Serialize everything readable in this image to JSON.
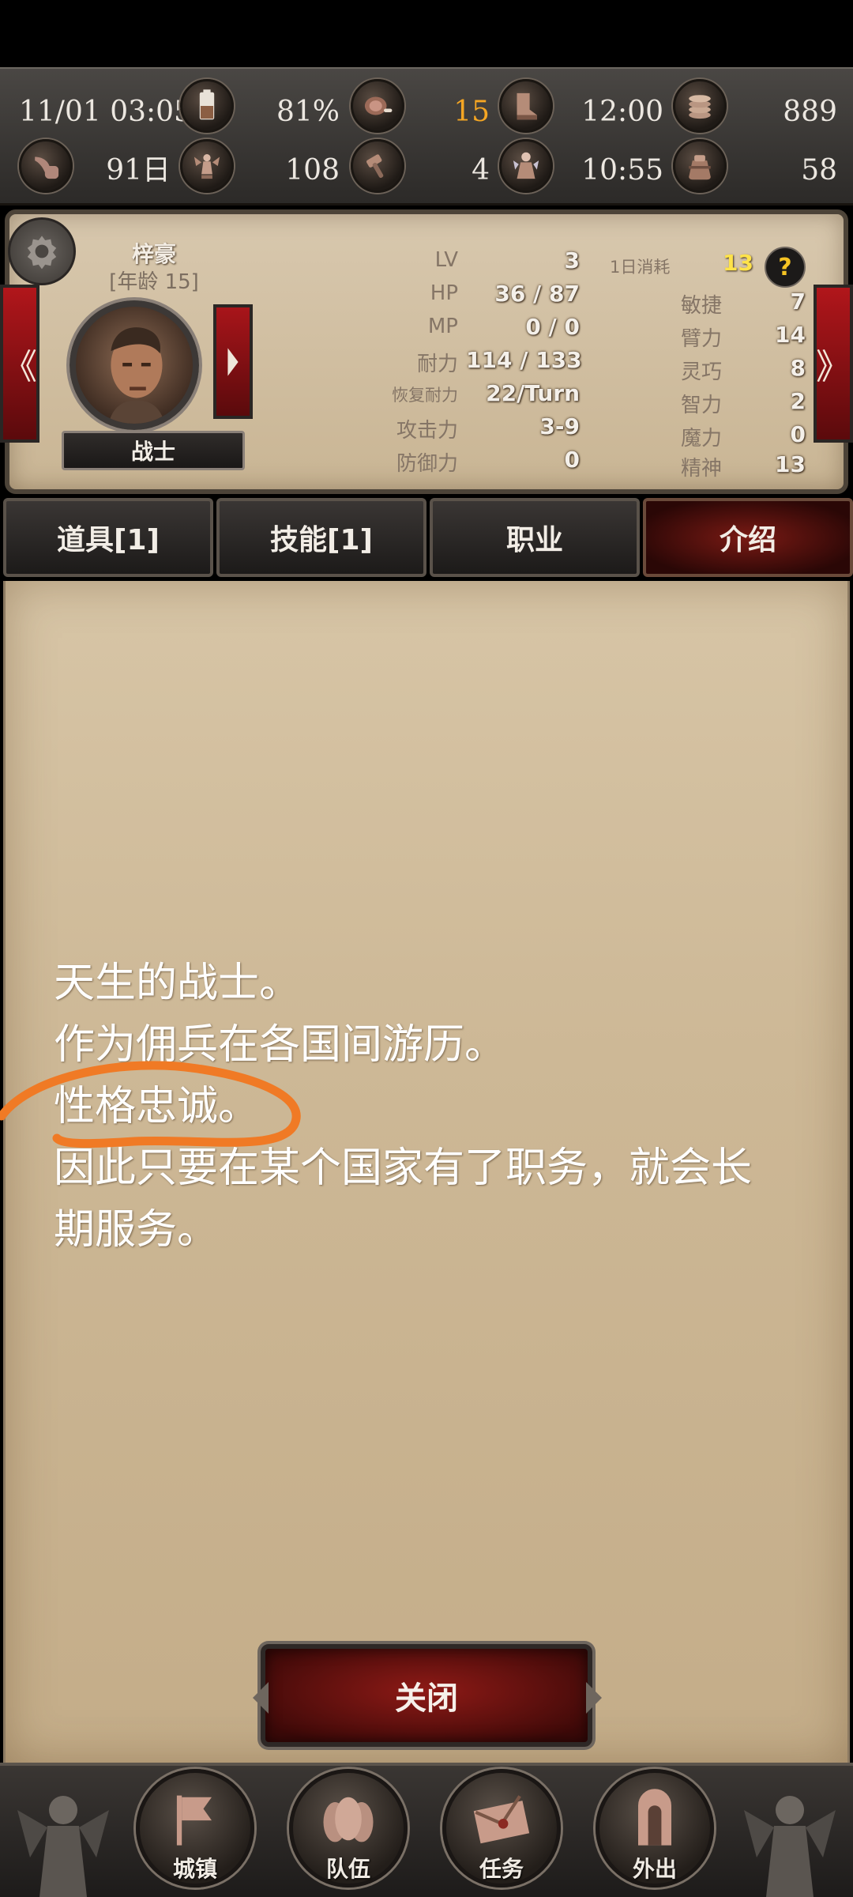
{
  "status_bar": {
    "datetime": "11/01 03:05",
    "battery_pct": "81%",
    "food": "15",
    "time_a": "12:00",
    "gold": "889",
    "days": "91日",
    "fame": "108",
    "count_a": "4",
    "time_b": "10:55",
    "count_b": "58",
    "icons": [
      "pipe-icon",
      "battery-icon",
      "meat-icon",
      "boot-icon",
      "coins-icon",
      "angel-statue-icon",
      "hammer-icon",
      "fairy-icon",
      "bag-icon"
    ],
    "colors": {
      "food": "#f5a623"
    }
  },
  "character": {
    "name": "梓豪",
    "age": "[年龄 15]",
    "class_name": "战士",
    "nav_prev": "《",
    "nav_next": "》",
    "daily_cost_label": "1日消耗",
    "daily_cost_value": "13",
    "help": "?",
    "stats_left": [
      {
        "label": "LV",
        "value": "3"
      },
      {
        "label": "HP",
        "value": "36 / 87"
      },
      {
        "label": "MP",
        "value": "0 / 0"
      },
      {
        "label": "耐力",
        "value": "114 / 133"
      },
      {
        "label": "恢复耐力",
        "value": "22/Turn"
      },
      {
        "label": "攻击力",
        "value": "3-9"
      },
      {
        "label": "防御力",
        "value": "0"
      }
    ],
    "stats_right": [
      {
        "label": "敏捷",
        "value": "7"
      },
      {
        "label": "臂力",
        "value": "14"
      },
      {
        "label": "灵巧",
        "value": "8"
      },
      {
        "label": "智力",
        "value": "2"
      },
      {
        "label": "魔力",
        "value": "0"
      },
      {
        "label": "精神",
        "value": "13"
      }
    ]
  },
  "tabs": [
    {
      "label": "道具[1]",
      "active": false
    },
    {
      "label": "技能[1]",
      "active": false
    },
    {
      "label": "职业",
      "active": false
    },
    {
      "label": "介绍",
      "active": true
    }
  ],
  "description": [
    "天生的战士。",
    "作为佣兵在各国间游历。",
    "性格忠诚。",
    "因此只要在某个国家有了职务，就会长",
    "期服务。"
  ],
  "close_label": "关闭",
  "bottom_nav": [
    {
      "label": "城镇",
      "icon": "flag-icon"
    },
    {
      "label": "队伍",
      "icon": "party-icon"
    },
    {
      "label": "任务",
      "icon": "envelope-icon"
    },
    {
      "label": "外出",
      "icon": "door-icon"
    }
  ]
}
